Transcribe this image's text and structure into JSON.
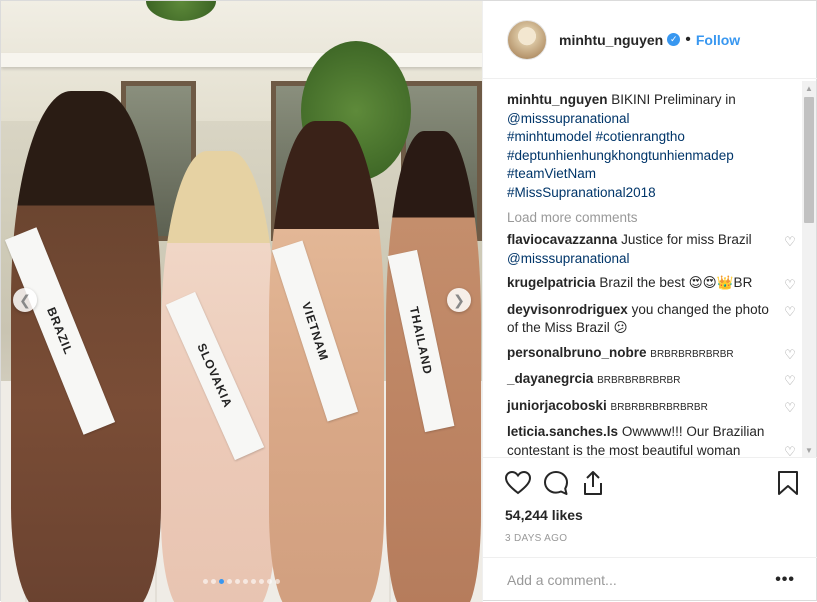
{
  "post": {
    "username": "minhtu_nguyen",
    "follow_label": "Follow",
    "separator": "•",
    "caption_text": "BIKINI Preliminary in",
    "caption_lines": [
      "@misssupranational",
      "#minhtumodel #cotienrangtho",
      "#deptunhienhungkhongtunhienmadep",
      "#teamVietNam",
      "#MissSupranational2018"
    ],
    "load_more": "Load more comments",
    "comments": [
      {
        "user": "flaviocavazzanna",
        "text": "Justice for miss Brazil",
        "mention": "@misssupranational"
      },
      {
        "user": "krugelpatricia",
        "text": "Brazil the best 😍😍👑BR",
        "mention": ""
      },
      {
        "user": "deyvisonrodriguex",
        "text": "you changed the photo of the Miss Brazil 😕",
        "mention": ""
      },
      {
        "user": "personalbruno_nobre",
        "text": "BRBRBRBRBRBR",
        "mention": ""
      },
      {
        "user": "_dayanegrcia",
        "text": "BRBRBRBRBRBR",
        "mention": ""
      },
      {
        "user": "juniorjacoboski",
        "text": "BRBRBRBRBRBRBR",
        "mention": ""
      },
      {
        "user": "leticia.sanches.ls",
        "text": "Owwww!!! Our Brazilian contestant is the most beautiful woman even with your",
        "mention": ""
      }
    ],
    "likes": "54,244 likes",
    "timestamp": "3 DAYS AGO",
    "comment_placeholder": "Add a comment...",
    "more_label": "•••"
  },
  "photo": {
    "sashes": [
      "BRAZIL",
      "SLOVAKIA",
      "VIETNAM",
      "THAILAND"
    ],
    "carousel_total": 10,
    "carousel_active_index": 2
  },
  "icons": {
    "like": "heart-icon",
    "comment": "comment-bubble-icon",
    "share": "share-icon",
    "save": "bookmark-icon",
    "verified": "verified-badge-icon"
  },
  "colors": {
    "accent": "#3897f0",
    "hashtag": "#003569",
    "muted": "#999999"
  }
}
